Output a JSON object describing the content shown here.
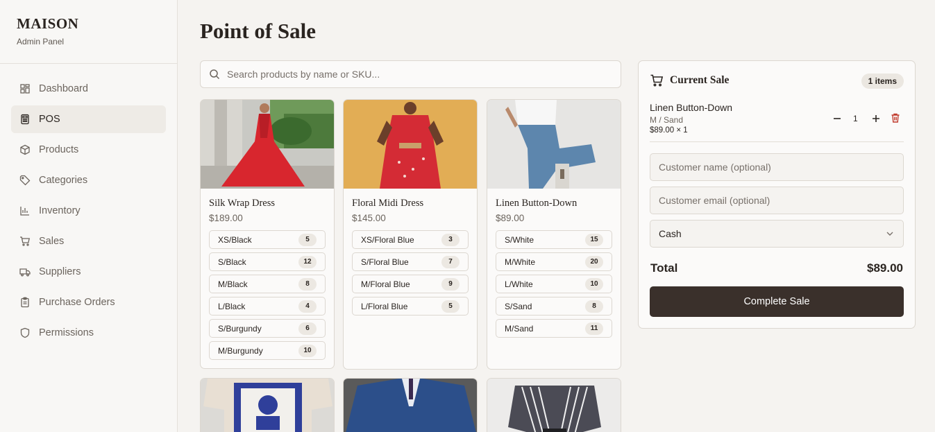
{
  "brand": {
    "title": "MAISON",
    "subtitle": "Admin Panel"
  },
  "sidebar": {
    "items": [
      {
        "label": "Dashboard",
        "icon": "dashboard-icon"
      },
      {
        "label": "POS",
        "icon": "calculator-icon",
        "active": true
      },
      {
        "label": "Products",
        "icon": "package-icon"
      },
      {
        "label": "Categories",
        "icon": "tag-icon"
      },
      {
        "label": "Inventory",
        "icon": "bar-chart-icon"
      },
      {
        "label": "Sales",
        "icon": "cart-icon"
      },
      {
        "label": "Suppliers",
        "icon": "truck-icon"
      },
      {
        "label": "Purchase Orders",
        "icon": "clipboard-icon"
      },
      {
        "label": "Permissions",
        "icon": "shield-icon"
      }
    ]
  },
  "main": {
    "title": "Point of Sale",
    "search_placeholder": "Search products by name or SKU..."
  },
  "products": [
    {
      "name": "Silk Wrap Dress",
      "price": "$189.00",
      "variants": [
        {
          "label": "XS/Black",
          "stock": "5"
        },
        {
          "label": "S/Black",
          "stock": "12"
        },
        {
          "label": "M/Black",
          "stock": "8"
        },
        {
          "label": "L/Black",
          "stock": "4"
        },
        {
          "label": "S/Burgundy",
          "stock": "6"
        },
        {
          "label": "M/Burgundy",
          "stock": "10"
        }
      ]
    },
    {
      "name": "Floral Midi Dress",
      "price": "$145.00",
      "variants": [
        {
          "label": "XS/Floral Blue",
          "stock": "3"
        },
        {
          "label": "S/Floral Blue",
          "stock": "7"
        },
        {
          "label": "M/Floral Blue",
          "stock": "9"
        },
        {
          "label": "L/Floral Blue",
          "stock": "5"
        }
      ]
    },
    {
      "name": "Linen Button-Down",
      "price": "$89.00",
      "variants": [
        {
          "label": "S/White",
          "stock": "15"
        },
        {
          "label": "M/White",
          "stock": "20"
        },
        {
          "label": "L/White",
          "stock": "10"
        },
        {
          "label": "S/Sand",
          "stock": "8"
        },
        {
          "label": "M/Sand",
          "stock": "11"
        }
      ]
    }
  ],
  "sale": {
    "title": "Current Sale",
    "items_badge": "1 items",
    "line": {
      "name": "Linen Button-Down",
      "variant": "M / Sand",
      "price_qty": "$89.00 × 1",
      "qty": "1"
    },
    "customer_name_placeholder": "Customer name (optional)",
    "customer_email_placeholder": "Customer email (optional)",
    "payment_method": "Cash",
    "total_label": "Total",
    "total_value": "$89.00",
    "complete_label": "Complete Sale"
  },
  "colors": {
    "accent": "#3a302b",
    "delete": "#c0392b",
    "background": "#f5f3f0"
  }
}
